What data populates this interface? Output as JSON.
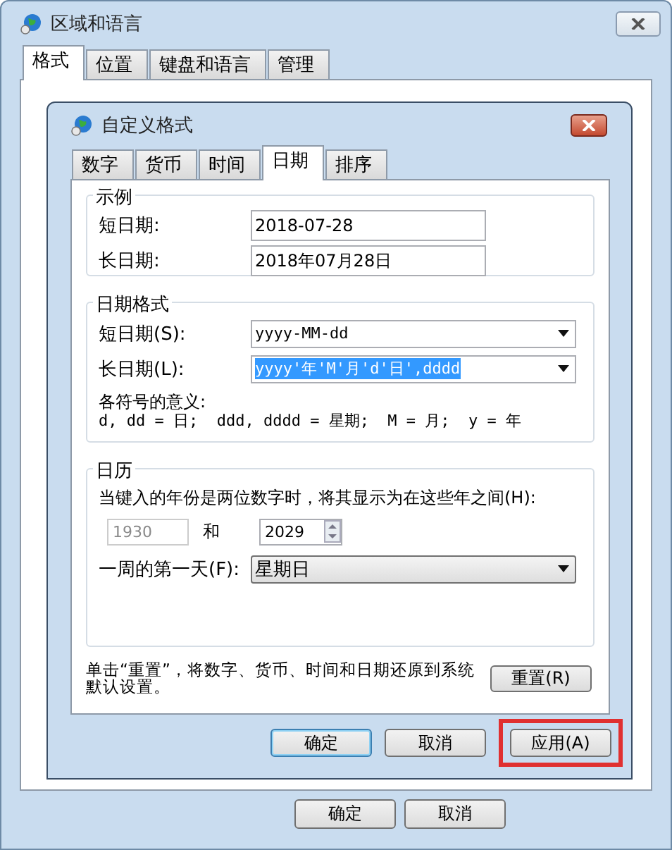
{
  "window": {
    "title": "区域和语言"
  },
  "tabs": [
    {
      "label": "格式",
      "selected": true
    },
    {
      "label": "位置",
      "selected": false
    },
    {
      "label": "键盘和语言",
      "selected": false
    },
    {
      "label": "管理",
      "selected": false
    }
  ],
  "buttons": [
    {
      "label": "确定"
    },
    {
      "label": "取消"
    }
  ],
  "dialog": {
    "title": "自定义格式",
    "tabs": [
      {
        "label": "数字",
        "selected": false
      },
      {
        "label": "货币",
        "selected": false
      },
      {
        "label": "时间",
        "selected": false
      },
      {
        "label": "日期",
        "selected": true
      },
      {
        "label": "排序",
        "selected": false
      }
    ],
    "example": {
      "title": "示例",
      "rows": [
        {
          "label": "短日期:",
          "value": "2018-07-28"
        },
        {
          "label": "长日期:",
          "value": "2018年07月28日"
        }
      ]
    },
    "formats": {
      "title": "日期格式",
      "rows": [
        {
          "label": "短日期(S):",
          "value": "yyyy-MM-dd",
          "highlighted": false
        },
        {
          "label": "长日期(L):",
          "value": "yyyy'年'M'月'd'日',dddd",
          "highlighted": true
        }
      ],
      "legend_title": "各符号的意义:",
      "legend": "d, dd = 日;  ddd, dddd = 星期;  M = 月;  y = 年"
    },
    "calendar": {
      "title": "日历",
      "note": "当键入的年份是两位数字时，将其显示为在这些年之间(H):",
      "from": "1930",
      "and": "和",
      "to": "2029",
      "first_day_label": "一周的第一天(F):",
      "first_day": "星期日"
    },
    "reset_note": "单击“重置”，将数字、货币、时间和日期还原到系统默认设置。",
    "reset_button": "重置(R)",
    "buttons": [
      {
        "label": "确定",
        "default": true,
        "highlighted": false
      },
      {
        "label": "取消",
        "default": false,
        "highlighted": false
      },
      {
        "label": "应用(A)",
        "default": false,
        "highlighted": true
      }
    ]
  }
}
